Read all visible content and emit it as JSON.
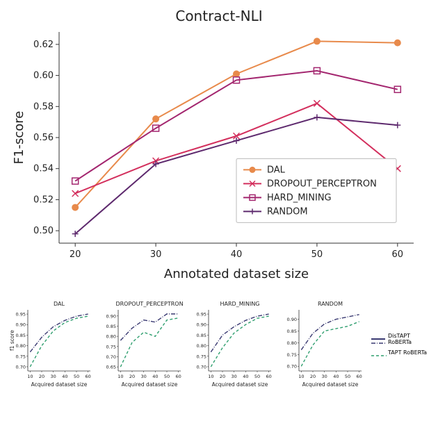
{
  "chart_data": [
    {
      "id": "main",
      "type": "line",
      "title": "Contract-NLI",
      "xlabel": "Annotated dataset size",
      "ylabel": "F1-score",
      "xticks": [
        20,
        30,
        40,
        50,
        60
      ],
      "yticks": [
        0.5,
        0.52,
        0.54,
        0.56,
        0.58,
        0.6,
        0.62
      ],
      "xlim": [
        18,
        62
      ],
      "ylim": [
        0.492,
        0.628
      ],
      "legend": [
        "DAL",
        "DROPOUT_PERCEPTRON",
        "HARD_MINING",
        "RANDOM"
      ],
      "series": [
        {
          "name": "DAL",
          "color": "#e88a4b",
          "marker": "circle",
          "x": [
            20,
            30,
            40,
            50,
            60
          ],
          "y": [
            0.515,
            0.572,
            0.601,
            0.622,
            0.621
          ]
        },
        {
          "name": "DROPOUT_PERCEPTRON",
          "color": "#d32f5d",
          "marker": "x",
          "x": [
            20,
            30,
            40,
            50,
            60
          ],
          "y": [
            0.524,
            0.545,
            0.561,
            0.582,
            0.54
          ]
        },
        {
          "name": "HARD_MINING",
          "color": "#a3266f",
          "marker": "square",
          "x": [
            20,
            30,
            40,
            50,
            60
          ],
          "y": [
            0.532,
            0.566,
            0.597,
            0.603,
            0.591
          ]
        },
        {
          "name": "RANDOM",
          "color": "#5e2a6e",
          "marker": "plus",
          "x": [
            20,
            30,
            40,
            50,
            60
          ],
          "y": [
            0.498,
            0.543,
            0.558,
            0.573,
            0.568
          ]
        }
      ]
    },
    {
      "id": "small-dal",
      "type": "line",
      "title": "DAL",
      "xlabel": "Acquired dataset size",
      "ylabel": "f1 score",
      "xticks": [
        10,
        20,
        30,
        40,
        50,
        60
      ],
      "yticks": [
        0.7,
        0.75,
        0.8,
        0.85,
        0.9,
        0.95
      ],
      "xlim": [
        8,
        62
      ],
      "ylim": [
        0.68,
        0.97
      ],
      "series": [
        {
          "name": "DisTAPT RoBERTa",
          "color": "#3a3a72",
          "dash": "dashdot",
          "x": [
            10,
            20,
            30,
            40,
            50,
            60
          ],
          "y": [
            0.77,
            0.84,
            0.89,
            0.92,
            0.94,
            0.95
          ]
        },
        {
          "name": "TAPT RoBERTa",
          "color": "#2f9f6f",
          "dash": "dash",
          "x": [
            10,
            20,
            30,
            40,
            50,
            60
          ],
          "y": [
            0.7,
            0.8,
            0.87,
            0.91,
            0.93,
            0.94
          ]
        }
      ]
    },
    {
      "id": "small-dropout",
      "type": "line",
      "title": "DROPOUT_PERCEPTRON",
      "xlabel": "Acquired dataset size",
      "ylabel": "",
      "xticks": [
        10,
        20,
        30,
        40,
        50,
        60
      ],
      "yticks": [
        0.65,
        0.7,
        0.75,
        0.8,
        0.85,
        0.9
      ],
      "xlim": [
        8,
        62
      ],
      "ylim": [
        0.63,
        0.93
      ],
      "series": [
        {
          "name": "DisTAPT RoBERTa",
          "color": "#3a3a72",
          "dash": "dashdot",
          "x": [
            10,
            20,
            30,
            40,
            50,
            60
          ],
          "y": [
            0.78,
            0.84,
            0.88,
            0.87,
            0.91,
            0.91
          ]
        },
        {
          "name": "TAPT RoBERTa",
          "color": "#2f9f6f",
          "dash": "dash",
          "x": [
            10,
            20,
            30,
            40,
            50,
            60
          ],
          "y": [
            0.65,
            0.77,
            0.82,
            0.8,
            0.88,
            0.89
          ]
        }
      ]
    },
    {
      "id": "small-hard",
      "type": "line",
      "title": "HARD_MINING",
      "xlabel": "Acquired dataset size",
      "ylabel": "",
      "xticks": [
        10,
        20,
        30,
        40,
        50,
        60
      ],
      "yticks": [
        0.7,
        0.75,
        0.8,
        0.85,
        0.9,
        0.95
      ],
      "xlim": [
        8,
        62
      ],
      "ylim": [
        0.68,
        0.97
      ],
      "series": [
        {
          "name": "DisTAPT RoBERTa",
          "color": "#3a3a72",
          "dash": "dashdot",
          "x": [
            10,
            20,
            30,
            40,
            50,
            60
          ],
          "y": [
            0.77,
            0.85,
            0.89,
            0.92,
            0.94,
            0.95
          ]
        },
        {
          "name": "TAPT RoBERTa",
          "color": "#2f9f6f",
          "dash": "dash",
          "x": [
            10,
            20,
            30,
            40,
            50,
            60
          ],
          "y": [
            0.7,
            0.79,
            0.86,
            0.9,
            0.93,
            0.94
          ]
        }
      ]
    },
    {
      "id": "small-random",
      "type": "line",
      "title": "RANDOM",
      "xlabel": "Acquired dataset size",
      "ylabel": "",
      "xticks": [
        10,
        20,
        30,
        40,
        50,
        60
      ],
      "yticks": [
        0.7,
        0.75,
        0.8,
        0.85,
        0.9
      ],
      "xlim": [
        8,
        62
      ],
      "ylim": [
        0.68,
        0.94
      ],
      "series": [
        {
          "name": "DisTAPT RoBERTa",
          "color": "#3a3a72",
          "dash": "dashdot",
          "x": [
            10,
            20,
            30,
            40,
            50,
            60
          ],
          "y": [
            0.77,
            0.84,
            0.88,
            0.9,
            0.91,
            0.92
          ]
        },
        {
          "name": "TAPT RoBERTa",
          "color": "#2f9f6f",
          "dash": "dash",
          "x": [
            10,
            20,
            30,
            40,
            50,
            60
          ],
          "y": [
            0.7,
            0.79,
            0.85,
            0.86,
            0.87,
            0.89
          ]
        }
      ]
    }
  ],
  "small_legend": {
    "items": [
      {
        "name": "DisTAPT RoBERTa",
        "color": "#3a3a72",
        "dash": "dashdot"
      },
      {
        "name": "TAPT RoBERTa",
        "color": "#2f9f6f",
        "dash": "dash"
      }
    ]
  }
}
